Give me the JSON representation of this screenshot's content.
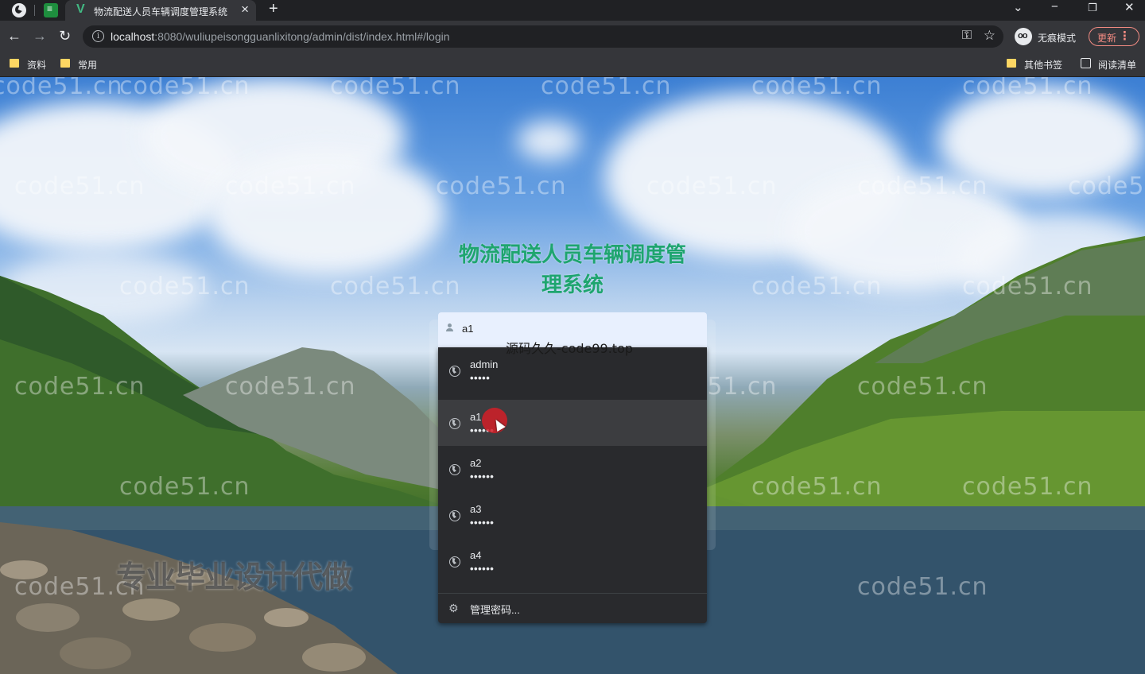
{
  "browser": {
    "tab_title": "物流配送人员车辆调度管理系统",
    "url_host": "localhost",
    "url_rest": ":8080/wuliupeisongguanlixitong/admin/dist/index.html#/login",
    "incognito_label": "无痕模式",
    "update_label": "更新",
    "bookmarks": [
      "资料",
      "常用"
    ],
    "bookmarks_right": [
      "其他书签",
      "阅读清单"
    ]
  },
  "page": {
    "title_line1": "物流配送人员车辆调度管",
    "title_line2": "理系统",
    "username_value": "a1",
    "overlay_text": "源码久久-code99.top",
    "promo_text": "专业毕业设计代做",
    "watermark": "code51.cn"
  },
  "autofill": {
    "items": [
      {
        "user": "admin",
        "pass": "•••••"
      },
      {
        "user": "a1",
        "pass": "••••••"
      },
      {
        "user": "a2",
        "pass": "••••••"
      },
      {
        "user": "a3",
        "pass": "••••••"
      },
      {
        "user": "a4",
        "pass": "••••••"
      }
    ],
    "manage_label": "管理密码..."
  }
}
